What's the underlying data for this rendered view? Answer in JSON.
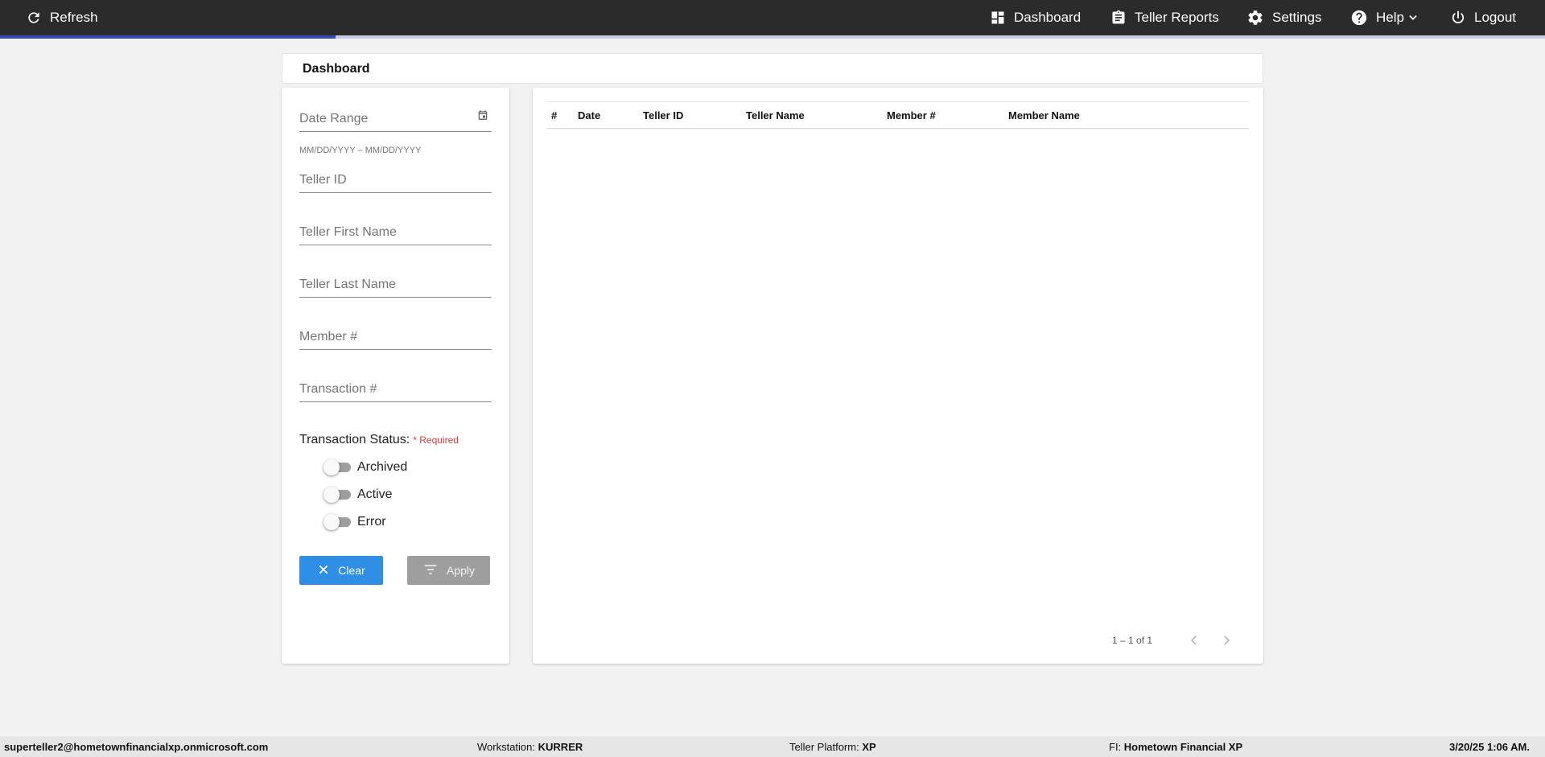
{
  "topbar": {
    "refresh_label": "Refresh",
    "nav": {
      "dashboard": "Dashboard",
      "teller_reports": "Teller Reports",
      "settings": "Settings",
      "help": "Help",
      "logout": "Logout"
    },
    "load_progress_fraction": 0.217
  },
  "page": {
    "title": "Dashboard"
  },
  "filters": {
    "date_range_placeholder": "Date Range",
    "date_range_hint": "MM/DD/YYYY – MM/DD/YYYY",
    "teller_id_placeholder": "Teller ID",
    "teller_first_name_placeholder": "Teller First Name",
    "teller_last_name_placeholder": "Teller Last Name",
    "member_number_placeholder": "Member #",
    "transaction_number_placeholder": "Transaction #",
    "status_label": "Transaction Status:",
    "required_note": "* Required",
    "toggles": [
      {
        "label": "Archived",
        "on": false
      },
      {
        "label": "Active",
        "on": false
      },
      {
        "label": "Error",
        "on": false
      }
    ],
    "clear_label": "Clear",
    "apply_label": "Apply"
  },
  "table": {
    "columns": [
      "#",
      "Date",
      "Teller ID",
      "Teller Name",
      "Member #",
      "Member Name"
    ],
    "rows": [],
    "pagination": "1 – 1 of 1"
  },
  "footer": {
    "user": "superteller2@hometownfinancialxp.onmicrosoft.com",
    "workstation_label": "Workstation:",
    "workstation": "KURRER",
    "platform_label": "Teller Platform:",
    "platform": "XP",
    "fi_label": "FI:",
    "fi": "Hometown Financial XP",
    "datetime": "3/20/25 1:06 AM."
  },
  "colors": {
    "topbar": "#2b2b2b",
    "progress": "#3949ab",
    "clear_button": "#2f8ee5",
    "apply_button": "#9e9e9e",
    "required": "#e53935"
  },
  "icons": {
    "refresh": "refresh-icon",
    "dashboard": "dashboard-icon",
    "teller_reports": "clipboard-icon",
    "settings": "gear-icon",
    "help": "help-circle-icon",
    "logout": "power-icon",
    "date_range": "calendar-icon",
    "clear": "close-icon",
    "apply": "filter-icon"
  }
}
